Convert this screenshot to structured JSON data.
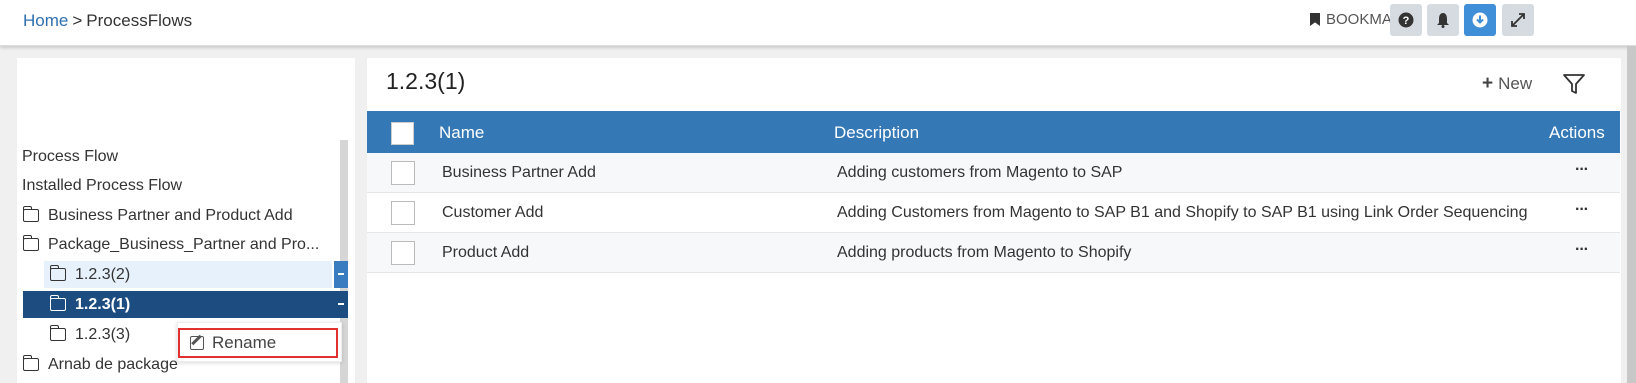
{
  "breadcrumb": {
    "home": "Home",
    "separator": ">",
    "current": "ProcessFlows"
  },
  "header": {
    "bookmarks_label": "BOOKMARKS"
  },
  "tree": {
    "items": [
      {
        "label": "Process Flow"
      },
      {
        "label": "Installed Process Flow"
      },
      {
        "label": "Business Partner and Product Add"
      },
      {
        "label": "Package_Business_Partner and Pro..."
      },
      {
        "label": "1.2.3(2)"
      },
      {
        "label": "1.2.3(1)"
      },
      {
        "label": "1.2.3(3)"
      },
      {
        "label": "Arnab de package"
      }
    ],
    "context_menu": {
      "rename_label": "Rename"
    }
  },
  "main": {
    "title": "1.2.3(1)",
    "new_label": "New",
    "columns": {
      "name": "Name",
      "description": "Description",
      "actions": "Actions"
    },
    "rows": [
      {
        "name": "Business Partner Add",
        "description": "Adding customers from Magento to SAP",
        "actions": "···"
      },
      {
        "name": "Customer Add",
        "description": "Adding Customers from Magento to SAP B1 and Shopify to SAP B1 using Link Order Sequencing",
        "actions": "···"
      },
      {
        "name": "Product Add",
        "description": "Adding products from Magento to Shopify",
        "actions": "···"
      }
    ]
  },
  "colors": {
    "header_blue": "#3478b6",
    "selected_node": "#1d4d80",
    "rename_border": "#e03030",
    "download_button": "#3e8fd8"
  },
  "icons": [
    "bookmark-icon",
    "help-icon",
    "bell-icon",
    "download-icon",
    "expand-icon",
    "folder-icon",
    "edit-icon",
    "plus-icon",
    "filter-icon",
    "ellipsis-icon"
  ]
}
